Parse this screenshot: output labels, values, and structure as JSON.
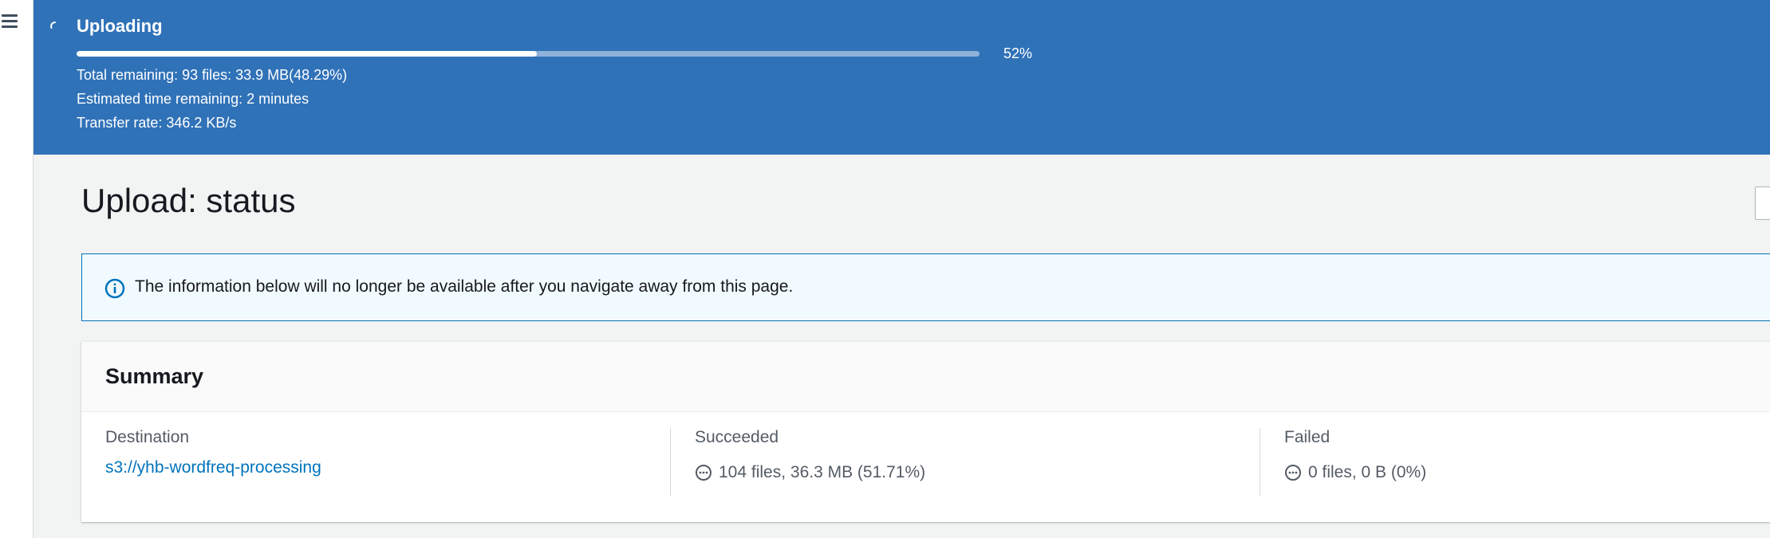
{
  "nav": {
    "menu_icon": "hamburger-menu-icon"
  },
  "banner": {
    "title": "Uploading",
    "progress_fraction": 0.51,
    "progress_label": "52%",
    "total_remaining": "Total remaining: 93 files: 33.9 MB(48.29%)",
    "estimated_time": "Estimated time remaining: 2 minutes",
    "transfer_rate": "Transfer rate: 346.2 KB/s",
    "background_color": "#3072b8",
    "spinner_icon": "loading-spinner-icon"
  },
  "page": {
    "title": "Upload: status"
  },
  "info_alert": {
    "icon": "info-icon",
    "text": "The information below will no longer be available after you navigate away from this page.",
    "border_color": "#0073bb"
  },
  "summary": {
    "title": "Summary",
    "destination": {
      "label": "Destination",
      "value": "s3://yhb-wordfreq-processing"
    },
    "succeeded": {
      "label": "Succeeded",
      "icon": "in-progress-icon",
      "value": "104 files, 36.3 MB (51.71%)"
    },
    "failed": {
      "label": "Failed",
      "icon": "in-progress-icon",
      "value": "0 files, 0 B (0%)"
    }
  }
}
